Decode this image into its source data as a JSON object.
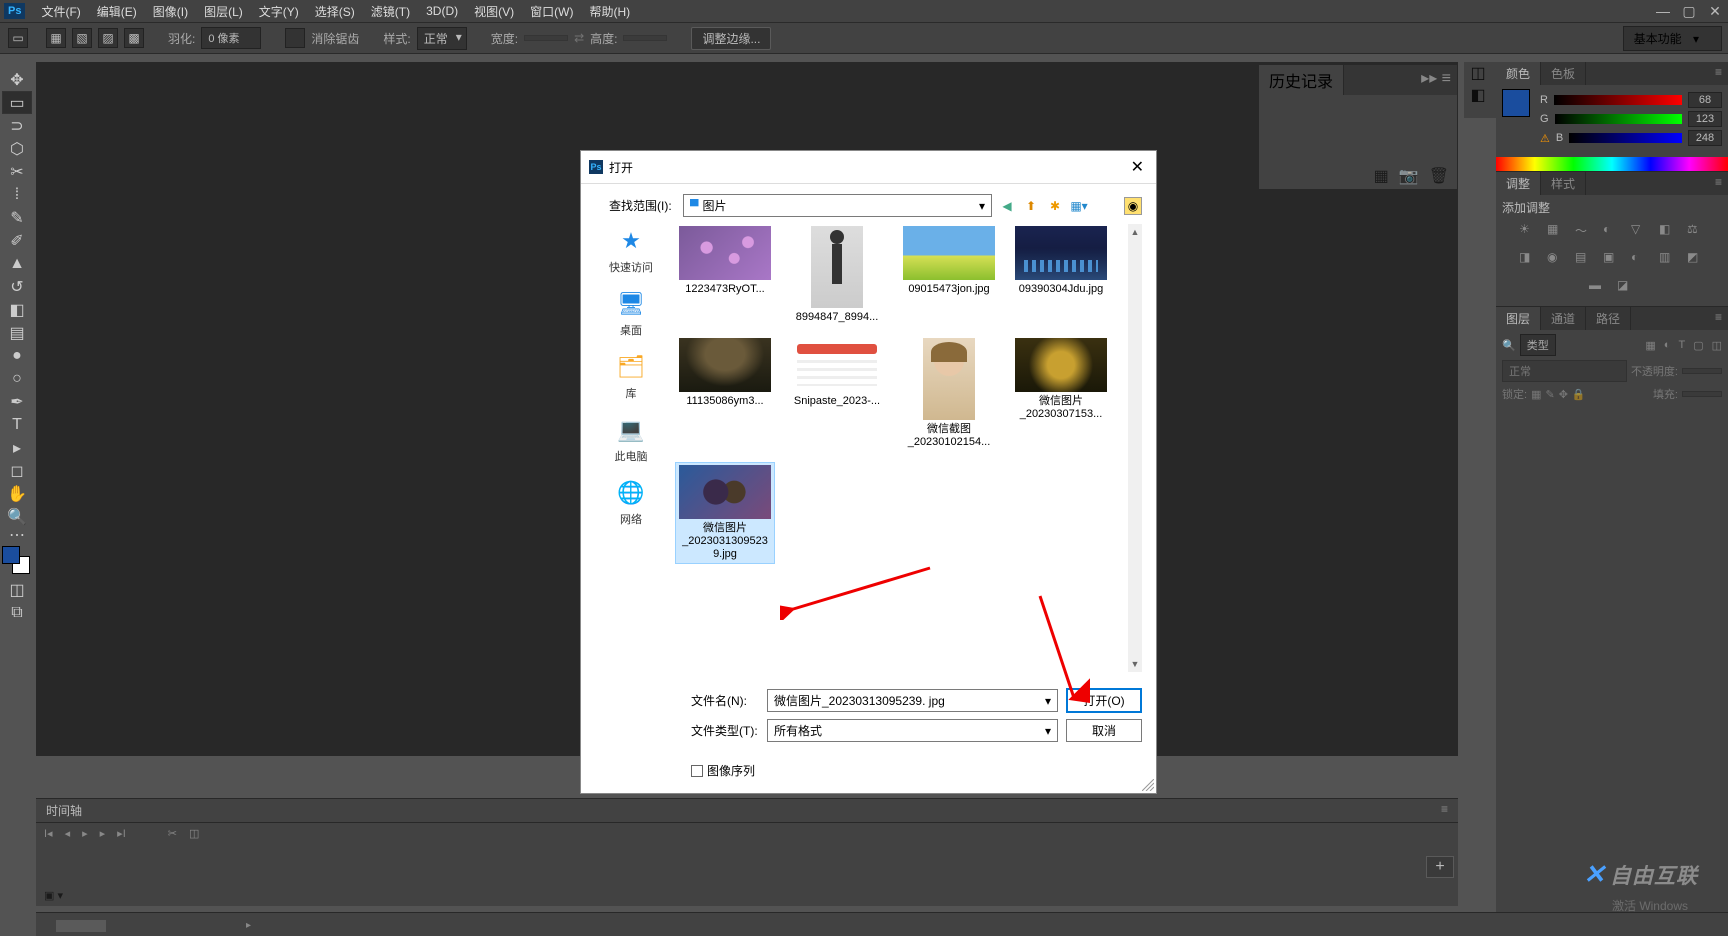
{
  "menubar": {
    "items": [
      "文件(F)",
      "编辑(E)",
      "图像(I)",
      "图层(L)",
      "文字(Y)",
      "选择(S)",
      "滤镜(T)",
      "3D(D)",
      "视图(V)",
      "窗口(W)",
      "帮助(H)"
    ]
  },
  "optionsbar": {
    "feather_label": "羽化:",
    "feather_value": "0 像素",
    "antialias_label": "消除锯齿",
    "style_label": "样式:",
    "style_value": "正常",
    "width_label": "宽度:",
    "height_label": "高度:",
    "refine_edge": "调整边缘...",
    "workspace": "基本功能"
  },
  "history_panel": {
    "title": "历史记录"
  },
  "color_panel": {
    "tab_color": "颜色",
    "tab_swatch": "色板",
    "r": "68",
    "g": "123",
    "b": "248",
    "r_label": "R",
    "g_label": "G",
    "b_label": "B"
  },
  "adjust_panel": {
    "tab_adjust": "调整",
    "tab_style": "样式",
    "add_label": "添加调整"
  },
  "layers_panel": {
    "tab_layers": "图层",
    "tab_channels": "通道",
    "tab_paths": "路径",
    "kind_label": "类型",
    "blend_value": "正常",
    "opacity_label": "不透明度:",
    "lock_label": "锁定:",
    "fill_label": "填充:"
  },
  "timeline": {
    "title": "时间轴"
  },
  "dialog": {
    "title": "打开",
    "lookin_label": "查找范围(I):",
    "lookin_value": "图片",
    "sidebar": [
      {
        "icon": "star",
        "label": "快速访问",
        "color": "#1e88e5"
      },
      {
        "icon": "desktop",
        "label": "桌面",
        "color": "#1e88e5"
      },
      {
        "icon": "library",
        "label": "库",
        "color": "#f9a825"
      },
      {
        "icon": "pc",
        "label": "此电脑",
        "color": "#546e7a"
      },
      {
        "icon": "network",
        "label": "网络",
        "color": "#1e88e5"
      }
    ],
    "files": [
      {
        "name": "1223473RyOT...",
        "bg": "linear-gradient(135deg,#7b5a9a,#a977c7)",
        "overlay": "flowers"
      },
      {
        "name": "8994847_8994...",
        "bg": "linear-gradient(#ddd,#ccc)",
        "overlay": "person",
        "tall": true
      },
      {
        "name": "09015473jon.jpg",
        "bg": "linear-gradient(#6ab0e8 55%,#d6e055 55%,#8bbf2e)"
      },
      {
        "name": "09390304Jdu.jpg",
        "bg": "linear-gradient(#1a2450,#0d1330)",
        "overlay": "city"
      },
      {
        "name": "11135086ym3...",
        "bg": "linear-gradient(#3a3320,#1a1a10)",
        "overlay": "storm"
      },
      {
        "name": "Snipaste_2023-...",
        "bg": "#fff",
        "overlay": "page"
      },
      {
        "name": "微信截图_20230102154...",
        "bg": "linear-gradient(#e8d8c0,#d0b890)",
        "overlay": "portrait",
        "tall": true
      },
      {
        "name": "微信图片_20230307153...",
        "bg": "linear-gradient(#3a3010,#1a1808)",
        "overlay": "gold"
      },
      {
        "name": "微信图片_2023031309523 9.jpg",
        "bg": "linear-gradient(135deg,#2a5a9a,#7a4a7a)",
        "overlay": "anime",
        "selected": true
      }
    ],
    "filename_label": "文件名(N):",
    "filename_value": "微信图片_20230313095239. jpg",
    "filetype_label": "文件类型(T):",
    "filetype_value": "所有格式",
    "open_btn": "打开(O)",
    "cancel_btn": "取消",
    "sequence_chk": "图像序列"
  },
  "watermark": "自由互联",
  "activate": "激活 Windows"
}
